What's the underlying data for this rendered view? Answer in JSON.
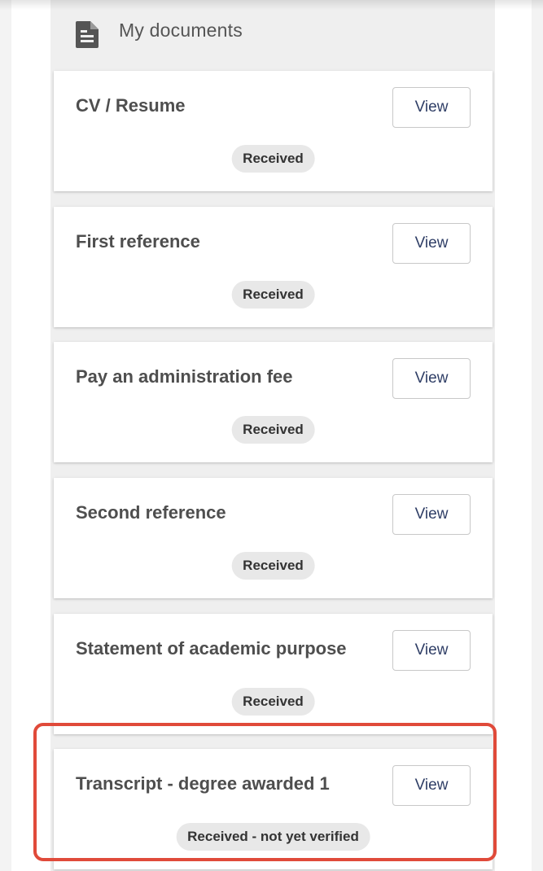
{
  "header": {
    "title": "My documents",
    "icon": "document-icon"
  },
  "documents": [
    {
      "title": "CV / Resume",
      "view_label": "View",
      "status": "Received"
    },
    {
      "title": "First reference",
      "view_label": "View",
      "status": "Received"
    },
    {
      "title": "Pay an administration fee",
      "view_label": "View",
      "status": "Received"
    },
    {
      "title": "Second reference",
      "view_label": "View",
      "status": "Received"
    },
    {
      "title": "Statement of academic purpose",
      "view_label": "View",
      "status": "Received"
    },
    {
      "title": "Transcript - degree awarded 1",
      "view_label": "View",
      "status": "Received - not yet verified"
    }
  ],
  "colors": {
    "highlight": "#e04a3a",
    "button_text": "#2f3e66",
    "badge_bg": "#e8e8e8"
  }
}
